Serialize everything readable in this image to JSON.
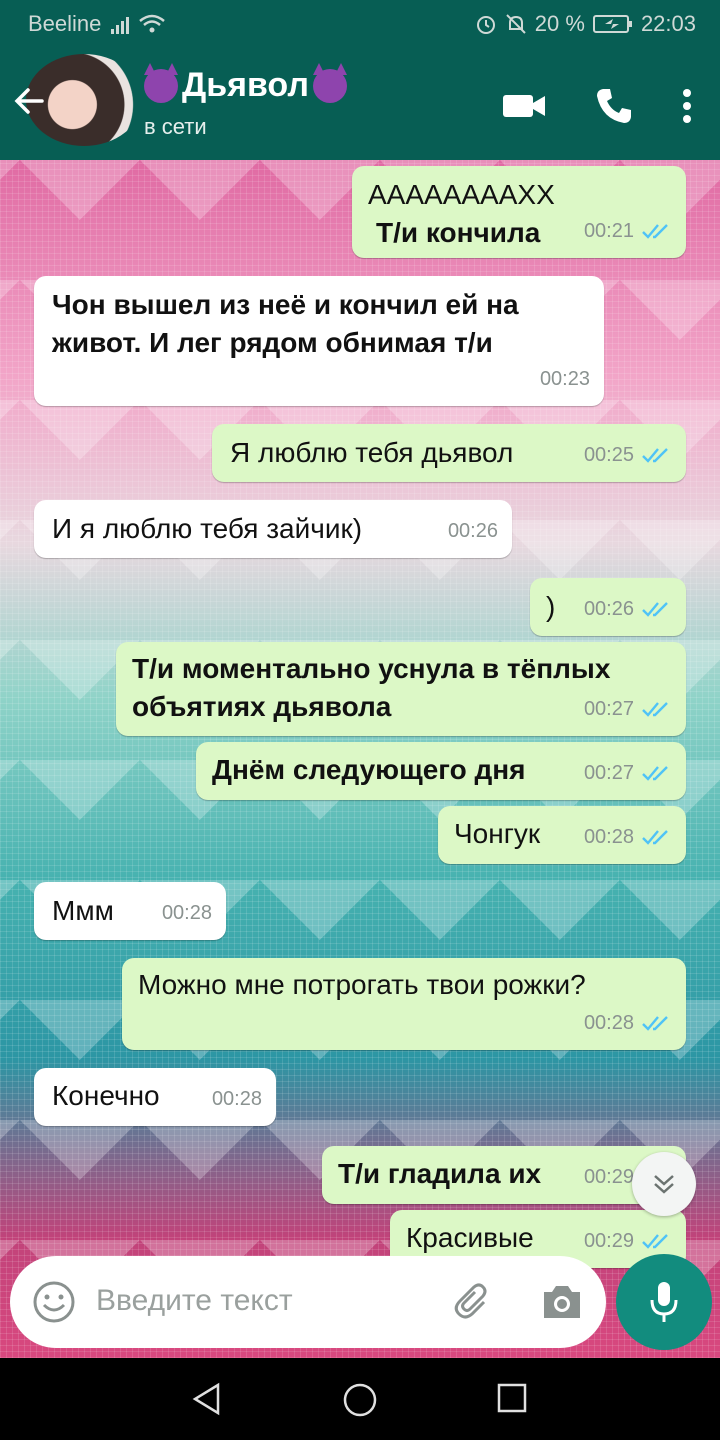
{
  "status_bar": {
    "carrier": "Beeline",
    "battery": "20 %",
    "time": "22:03"
  },
  "chat_header": {
    "back_icon": "arrow-left-icon",
    "contact_name": "Дьявол",
    "contact_status": "в сети",
    "actions": [
      "video-call-icon",
      "phone-icon",
      "more-vert-icon"
    ]
  },
  "messages": [
    {
      "direction": "out",
      "text": "ААААААААХХ",
      "text2": "Т/и кончила",
      "time": "00:21",
      "read": true
    },
    {
      "direction": "in",
      "text": "Чон вышел из неё и кончил ей на",
      "text2": "живот. И лег рядом обнимая т/и",
      "time": "00:23"
    },
    {
      "direction": "out",
      "text": "Я люблю тебя дьявол",
      "time": "00:25",
      "read": true
    },
    {
      "direction": "in",
      "text": "И я люблю тебя зайчик)",
      "time": "00:26"
    },
    {
      "direction": "out",
      "text": ")",
      "time": "00:26",
      "read": true
    },
    {
      "direction": "out",
      "text": "Т/и моментально уснула в тёплых",
      "text2": "объятиях дьявола",
      "time": "00:27",
      "read": true
    },
    {
      "direction": "out",
      "text": "Днём следующего дня",
      "time": "00:27",
      "read": true
    },
    {
      "direction": "out",
      "text": "Чонгук",
      "time": "00:28",
      "read": true
    },
    {
      "direction": "in",
      "text": "Ммм",
      "time": "00:28"
    },
    {
      "direction": "out",
      "text": "Можно мне потрогать твои рожки?",
      "time": "00:28",
      "read": true
    },
    {
      "direction": "in",
      "text": "Конечно",
      "time": "00:28"
    },
    {
      "direction": "out",
      "text": "Т/и гладила их",
      "time": "00:29",
      "read": true
    },
    {
      "direction": "out",
      "text": "Красивые",
      "time": "00:29",
      "read": true
    }
  ],
  "composer": {
    "placeholder": "Введите текст",
    "icons": [
      "emoji-icon",
      "attach-icon",
      "camera-icon",
      "mic-icon"
    ]
  },
  "colors": {
    "header": "#075e54",
    "outgoing_bubble": "#dcf8c6",
    "incoming_bubble": "#ffffff",
    "read_ticks": "#4fc3f7",
    "mic_button": "#128c7e"
  }
}
